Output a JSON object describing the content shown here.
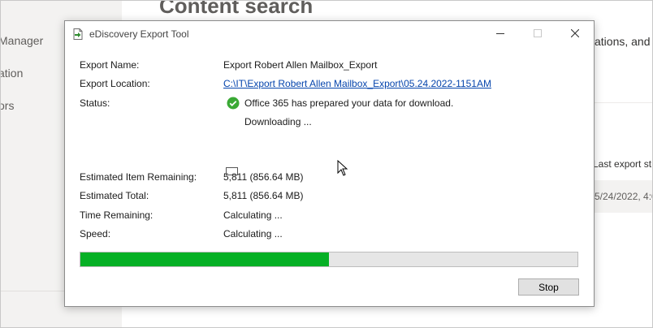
{
  "background": {
    "page_title": "Content search",
    "nav_items": [
      "Manager",
      "ation",
      "ors"
    ],
    "description_fragment": "ations, and",
    "column_header": "Last export st",
    "row_value": "5/24/2022, 4:0"
  },
  "dialog": {
    "title": "eDiscovery Export Tool",
    "fields": {
      "export_name_label": "Export Name:",
      "export_name_value": "Export Robert Allen Mailbox_Export",
      "export_location_label": "Export Location:",
      "export_location_value": "C:\\IT\\Export Robert Allen Mailbox_Export\\05.24.2022-1151AM",
      "status_label": "Status:",
      "status_value": "Office 365 has prepared your data for download.",
      "status_detail": "Downloading ...",
      "est_items_remaining_label": "Estimated Item Remaining:",
      "est_items_remaining_value": "5,811 (856.64 MB)",
      "est_total_label": "Estimated Total:",
      "est_total_value": "5,811 (856.64 MB)",
      "time_remaining_label": "Time Remaining:",
      "time_remaining_value": "Calculating ...",
      "speed_label": "Speed:",
      "speed_value": "Calculating ..."
    },
    "progress_fraction": 0.5,
    "stop_label": "Stop"
  },
  "colors": {
    "progress_fill": "#06b025",
    "status_check": "#3aa935",
    "link": "#0645ad"
  },
  "icons": [
    "export-app-icon",
    "minimize-icon",
    "maximize-icon",
    "close-icon",
    "success-check-icon",
    "ibeam-cursor-icon",
    "arrow-cursor-icon"
  ]
}
